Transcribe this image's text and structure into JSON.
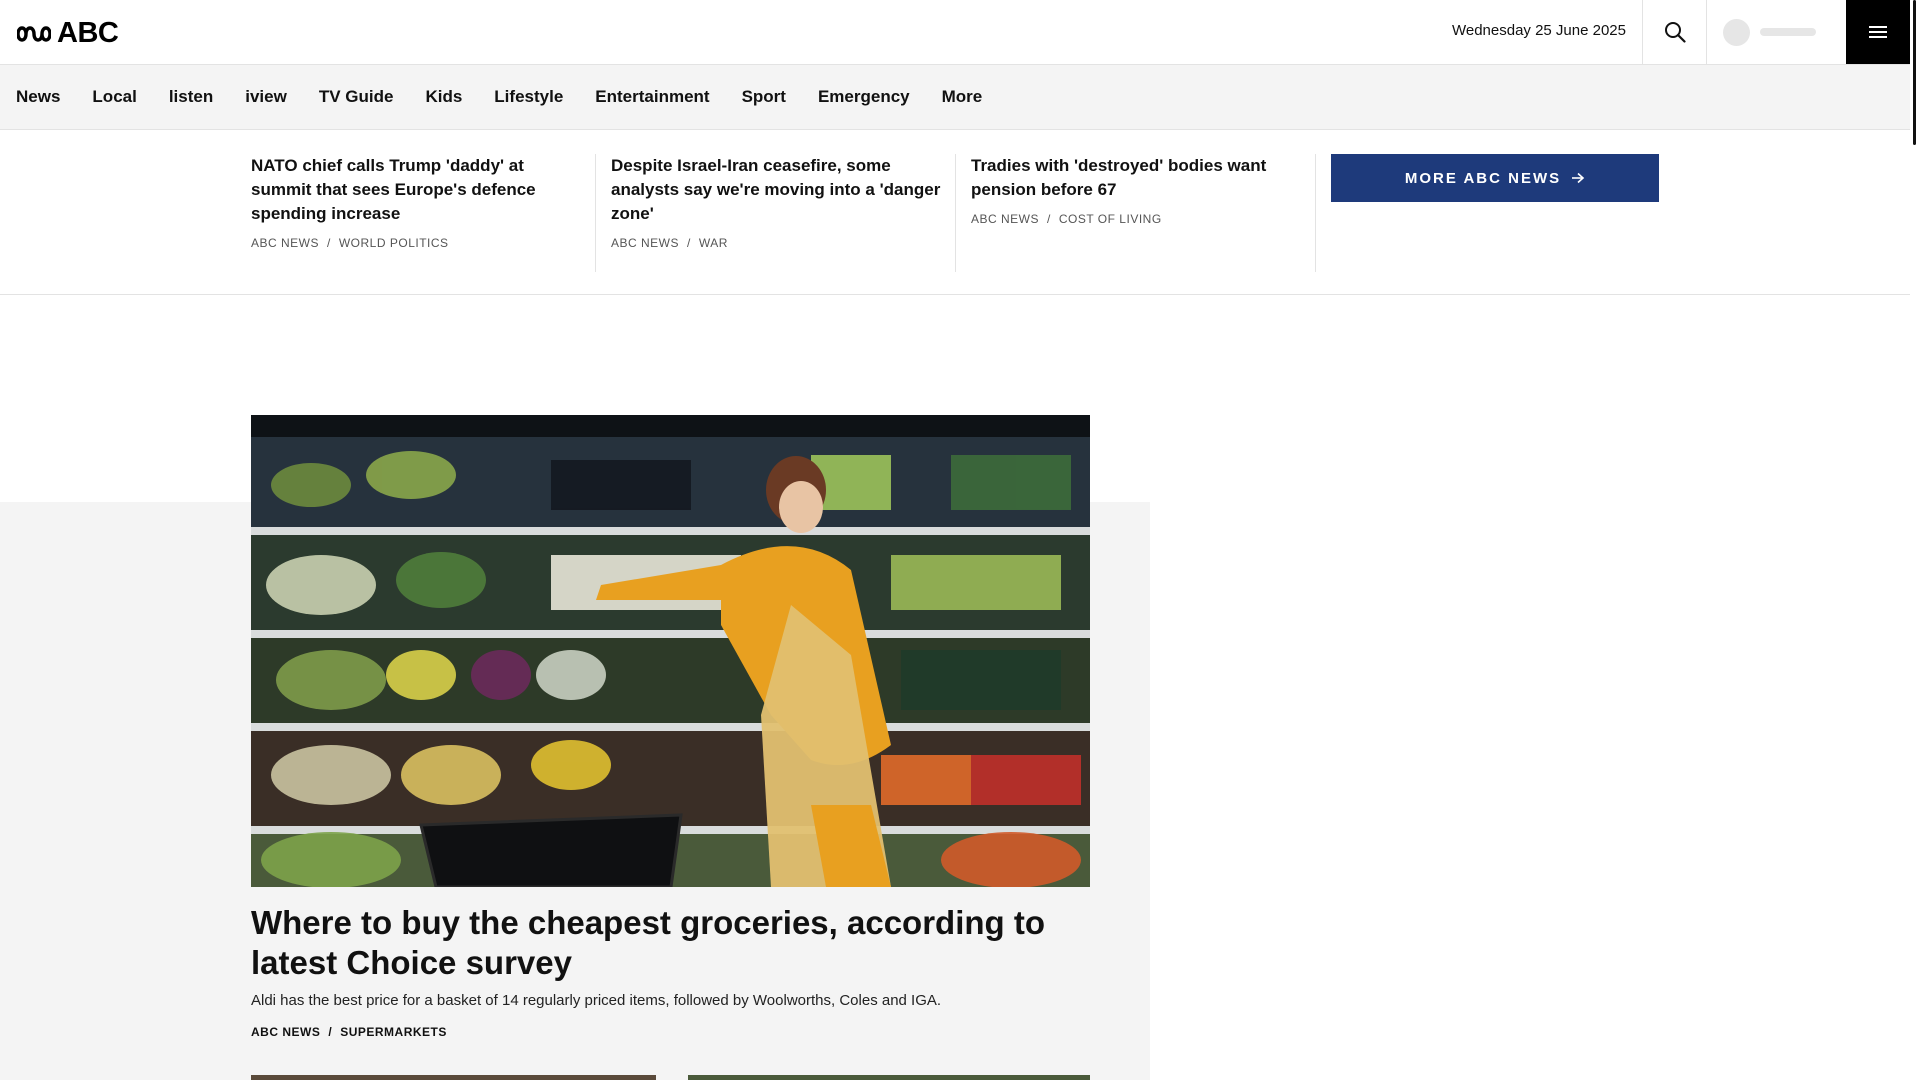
{
  "header": {
    "logo_text": "ABC",
    "date": "Wednesday 25 June 2025",
    "search_icon": "search-icon",
    "menu_icon": "hamburger-menu-icon"
  },
  "nav": {
    "items": [
      "News",
      "Local",
      "listen",
      "iview",
      "TV Guide",
      "Kids",
      "Lifestyle",
      "Entertainment",
      "Sport",
      "Emergency",
      "More"
    ]
  },
  "headlines": [
    {
      "title": "NATO chief calls Trump 'daddy' at summit that sees Europe's defence spending increase",
      "source": "ABC NEWS",
      "topic": "WORLD POLITICS"
    },
    {
      "title": "Despite Israel-Iran ceasefire, some analysts say we're moving into a 'danger zone'",
      "source": "ABC NEWS",
      "topic": "WAR"
    },
    {
      "title": "Tradies with 'destroyed' bodies want pension before 67",
      "source": "ABC NEWS",
      "topic": "COST OF LIVING"
    }
  ],
  "more_button": {
    "label": "MORE ABC NEWS",
    "icon": "arrow-right-icon"
  },
  "feature": {
    "image_alt": "woman-shopping-supermarket",
    "title": "Where to buy the cheapest groceries, according to latest Choice survey",
    "description": "Aldi has the best price for a basket of 14 regularly priced items, followed by Woolworths, Coles and IGA.",
    "source": "ABC NEWS",
    "topic": "SUPERMARKETS"
  },
  "colors": {
    "accent_button": "#1e3a7b",
    "menu_button": "#000000",
    "nav_bg": "#f4f4f4"
  }
}
